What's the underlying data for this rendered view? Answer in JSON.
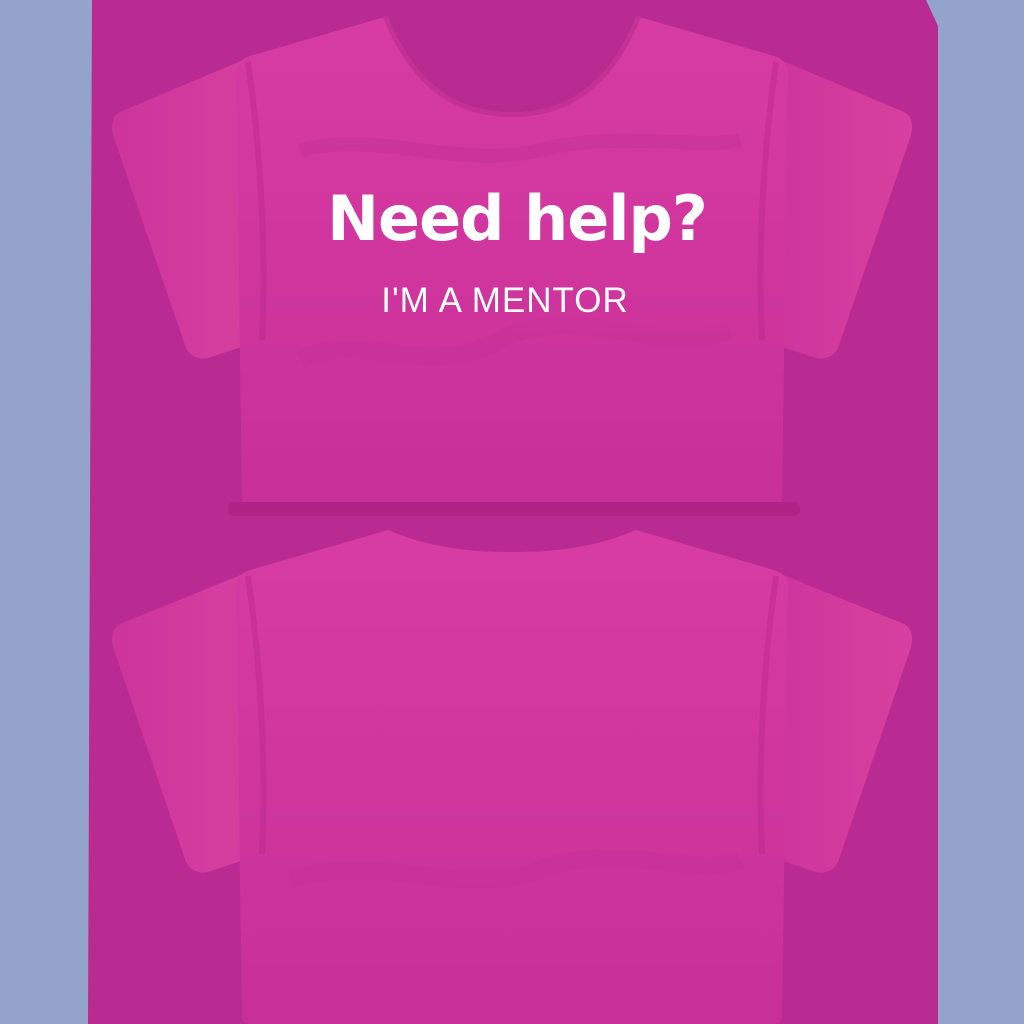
{
  "shirt_front": {
    "title": "Need help?",
    "subtitle": "I'M A MENTOR"
  },
  "colors": {
    "background": "#93a3c9",
    "template": "#b92a93",
    "shirt": "#cd349c",
    "shirt_highlight": "#d63ca2",
    "shirt_shadow": "#b22586",
    "text": "#ffffff"
  }
}
